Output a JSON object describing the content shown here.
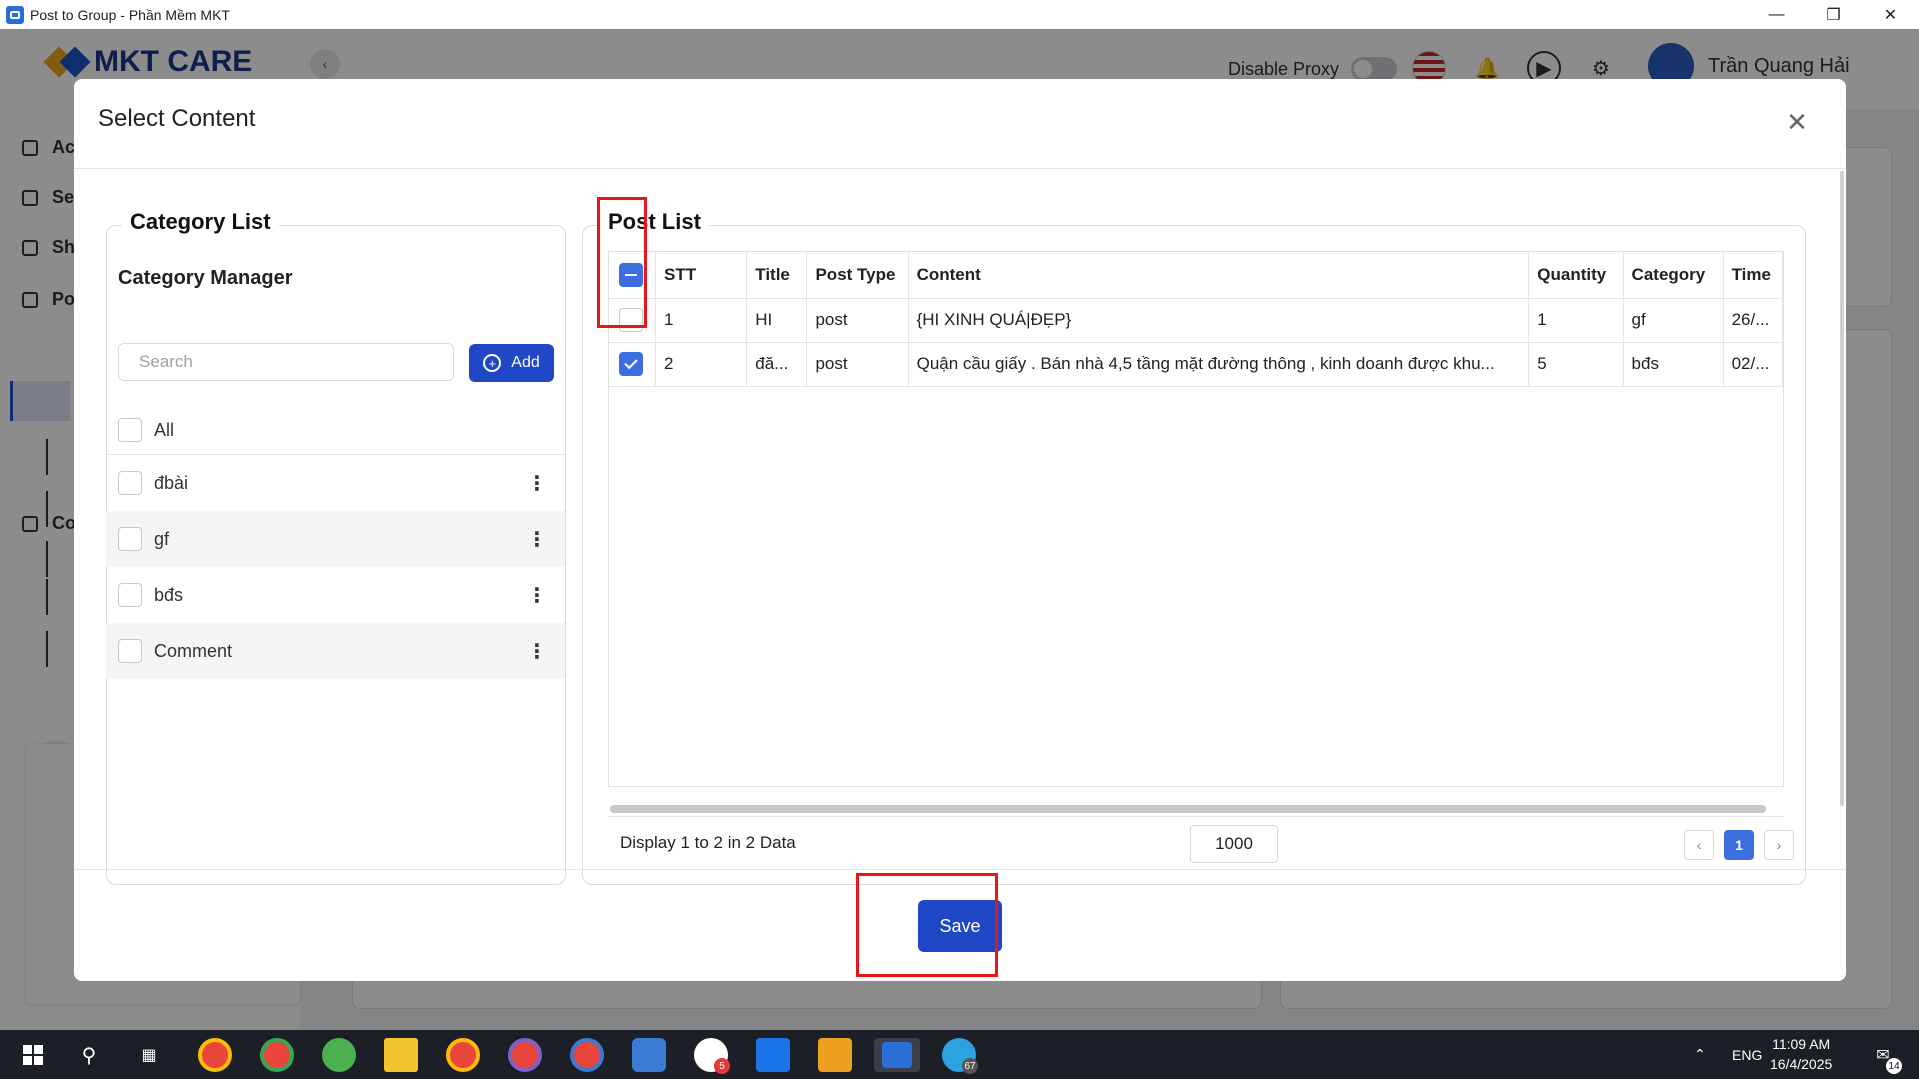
{
  "window": {
    "title": "Post to Group - Phần Mềm MKT"
  },
  "background": {
    "logo_text": "MKT CARE",
    "proxy_label": "Disable Proxy",
    "user_name": "Trần Quang Hải",
    "sidebar_labels": [
      "Ac",
      "Se",
      "Sh",
      "Po",
      "Co"
    ]
  },
  "modal": {
    "title": "Select Content",
    "save_label": "Save"
  },
  "category": {
    "legend": "Category List",
    "manager_title": "Category Manager",
    "search_placeholder": "Search",
    "add_label": "Add",
    "items": [
      {
        "label": "All"
      },
      {
        "label": "đbài"
      },
      {
        "label": "gf"
      },
      {
        "label": "bđs"
      },
      {
        "label": "Comment"
      }
    ]
  },
  "posts": {
    "legend": "Post List",
    "columns": [
      "STT",
      "Title",
      "Post Type",
      "Content",
      "Quantity",
      "Category",
      "Time"
    ],
    "rows": [
      {
        "stt": "1",
        "title": "HI",
        "type": "post",
        "content": "{HI XINH QUÁ|ĐẸP}",
        "quantity": "1",
        "category": "gf",
        "time": "26/...",
        "checked": false
      },
      {
        "stt": "2",
        "title": "đă...",
        "type": "post",
        "content": "Quận cầu giấy . Bán nhà 4,5 tầng mặt đường thông , kinh doanh được khu...",
        "quantity": "5",
        "category": "bđs",
        "time": "02/...",
        "checked": true
      }
    ],
    "display_text": "Display 1 to 2 in 2 Data",
    "page_size": "1000",
    "current_page": "1"
  },
  "taskbar": {
    "language": "ENG",
    "time": "11:09 AM",
    "date": "16/4/2025",
    "notification_count": "14",
    "zalo_badge": "5",
    "telegram_badge": "67"
  },
  "colors": {
    "primary": "#1f47c6",
    "checkbox": "#3d6ee0",
    "highlight": "#e8151b"
  }
}
